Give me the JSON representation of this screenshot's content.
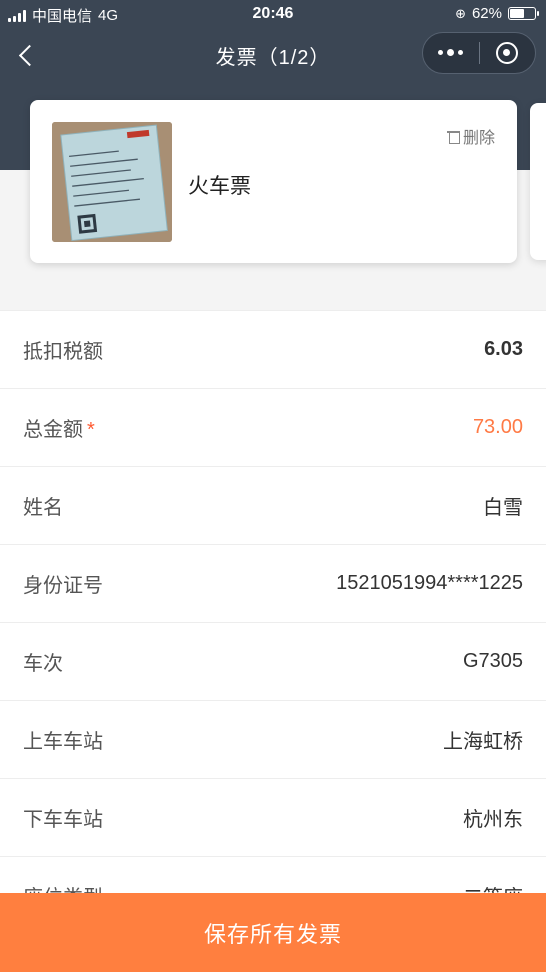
{
  "status_bar": {
    "carrier": "中国电信",
    "network": "4G",
    "time": "20:46",
    "battery": "62%",
    "battery_level": 0.62
  },
  "nav": {
    "title": "发票（1/2）"
  },
  "card": {
    "title": "火车票",
    "delete_label": "删除"
  },
  "fields": [
    {
      "label": "抵扣税额",
      "value": "6.03",
      "required": false
    },
    {
      "label": "总金额",
      "value": "73.00",
      "required": true,
      "required_mark": "*"
    },
    {
      "label": "姓名",
      "value": "白雪",
      "required": false
    },
    {
      "label": "身份证号",
      "value": "1521051994****1225",
      "required": false
    },
    {
      "label": "车次",
      "value": "G7305",
      "required": false
    },
    {
      "label": "上车车站",
      "value": "上海虹桥",
      "required": false
    },
    {
      "label": "下车车站",
      "value": "杭州东",
      "required": false
    },
    {
      "label": "座位类型",
      "value": "二等座",
      "required": false
    }
  ],
  "save_button": "保存所有发票",
  "colors": {
    "header": "#3b4654",
    "accent": "#ff7f3f",
    "amount": "#ff7a45"
  }
}
